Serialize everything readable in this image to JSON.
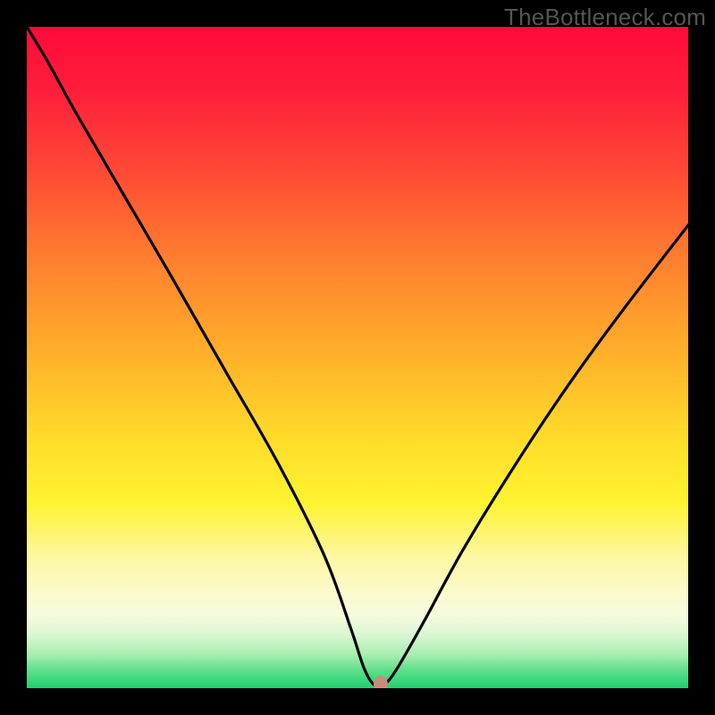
{
  "watermark": "TheBottleneck.com",
  "chart_data": {
    "type": "line",
    "title": "",
    "xlabel": "",
    "ylabel": "",
    "xlim": [
      0,
      100
    ],
    "ylim": [
      0,
      100
    ],
    "x": [
      0,
      3,
      8,
      15,
      22,
      30,
      38,
      45,
      49,
      51,
      52.5,
      54,
      56,
      60,
      66,
      74,
      82,
      90,
      100
    ],
    "y": [
      100,
      95,
      86,
      74,
      62,
      48,
      34,
      20,
      9,
      3,
      0.5,
      0.5,
      3,
      10,
      21,
      34,
      46,
      57,
      70
    ],
    "marker": {
      "x": 53.5,
      "y": 0.5
    },
    "background": "red-yellow-green vertical gradient"
  }
}
